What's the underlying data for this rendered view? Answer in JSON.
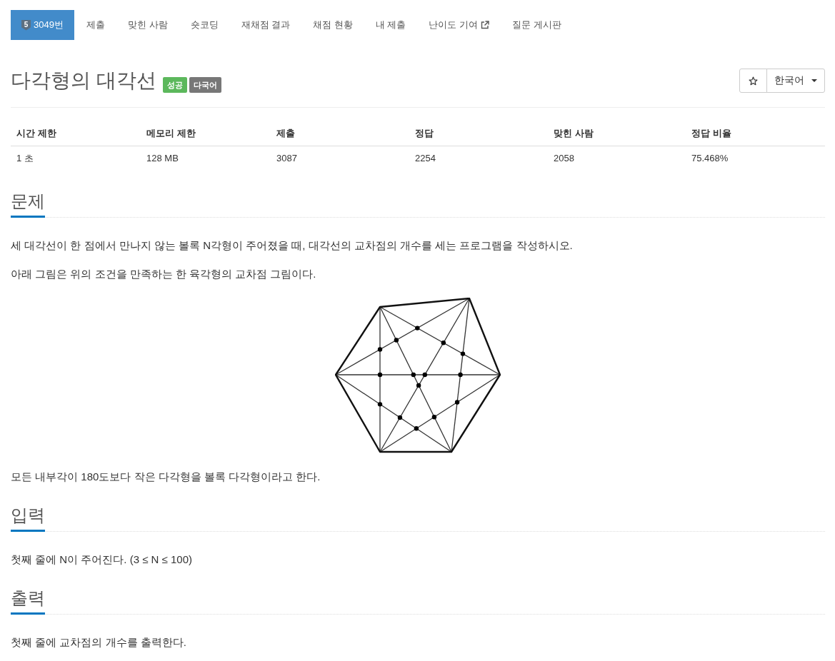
{
  "nav": {
    "tabs": [
      {
        "label": "3049번",
        "badge": "5",
        "external": false,
        "selected": true
      },
      {
        "label": "제출",
        "external": false,
        "selected": false
      },
      {
        "label": "맞힌 사람",
        "external": false,
        "selected": false
      },
      {
        "label": "숏코딩",
        "external": false,
        "selected": false
      },
      {
        "label": "재채점 결과",
        "external": false,
        "selected": false
      },
      {
        "label": "채점 현황",
        "external": false,
        "selected": false
      },
      {
        "label": "내 제출",
        "external": false,
        "selected": false
      },
      {
        "label": "난이도 기여",
        "external": true,
        "selected": false
      },
      {
        "label": "질문 게시판",
        "external": false,
        "selected": false
      }
    ]
  },
  "problem": {
    "title": "다각형의 대각선",
    "labels": [
      {
        "text": "성공",
        "color": "#5cb85c"
      },
      {
        "text": "다국어",
        "color": "#777777"
      }
    ],
    "language": "한국어"
  },
  "limits_table": {
    "columns": [
      "시간 제한",
      "메모리 제한",
      "제출",
      "정답",
      "맞힌 사람",
      "정답 비율"
    ],
    "rows": [
      [
        "1 초",
        "128 MB",
        "3087",
        "2254",
        "2058",
        "75.468%"
      ]
    ]
  },
  "sections": [
    {
      "heading": "문제",
      "blocks": [
        {
          "kind": "text",
          "text": "세 대각선이 한 점에서 만나지 않는 볼록 N각형이 주어졌을 때, 대각선의 교차점의 개수를 세는 프로그램을 작성하시오."
        },
        {
          "kind": "text",
          "text": "아래 그림은 위의 조건을 만족하는 한 육각형의 교차점 그림이다."
        },
        {
          "kind": "figure"
        },
        {
          "kind": "text",
          "text": "모든 내부각이 180도보다 작은 다각형을 볼록 다각형이라고 한다."
        }
      ]
    },
    {
      "heading": "입력",
      "blocks": [
        {
          "kind": "text",
          "text": "첫째 줄에 N이 주어진다. (3 ≤ N ≤ 100)"
        }
      ]
    },
    {
      "heading": "출력",
      "blocks": [
        {
          "kind": "text",
          "text": "첫째 줄에 교차점의 개수를 출력한다."
        }
      ]
    }
  ]
}
